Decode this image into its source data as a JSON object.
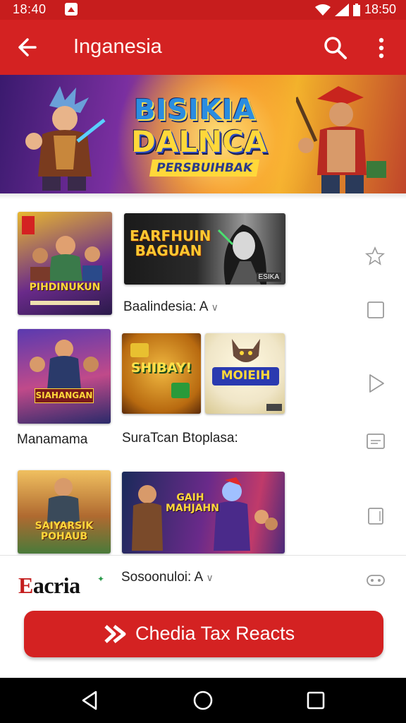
{
  "status_bar": {
    "time_left": "18:40",
    "time_right": "18:50",
    "icons": [
      "notification-icon",
      "wifi-icon",
      "signal-icon",
      "battery-icon"
    ]
  },
  "app_bar": {
    "title": "Inganesia",
    "icons": [
      "back-arrow-icon",
      "search-icon",
      "more-vert-icon"
    ]
  },
  "banner": {
    "line1": "BISIKIA",
    "line2": "DALNCA",
    "line3": "PERSBUIHBAK"
  },
  "rows": [
    {
      "label": "",
      "tiles": [
        {
          "name": "game-tile-fighters",
          "caption": "PIHDINUKUN"
        },
        {
          "name": "game-tile-earfhuin",
          "caption": "EARFHUIN BAGUAN",
          "badge": "ESIKA"
        }
      ],
      "item_label": "Baalindesia: A",
      "side_icons": [
        "star-outline-icon",
        "square-outline-icon"
      ]
    },
    {
      "label": "Manamama",
      "tiles": [
        {
          "name": "game-tile-heroes",
          "caption": "SIAHANGAN"
        },
        {
          "name": "game-tile-shibay",
          "caption": "SHIBAY!"
        },
        {
          "name": "game-tile-moieih",
          "caption": "MOIEIH"
        }
      ],
      "item_label": "SuraTcan Btoplasa:",
      "side_icons": [
        "play-outline-icon",
        "card-outline-icon"
      ]
    },
    {
      "label": "",
      "tiles": [
        {
          "name": "game-tile-saiyarsik",
          "caption": "SAIYARSIK POHAUB"
        },
        {
          "name": "game-tile-gaih",
          "caption": "GAIH MAHJAHN"
        }
      ],
      "side_icons": [
        "tablet-outline-icon"
      ]
    }
  ],
  "bottom": {
    "logo": "Eacria",
    "item_label": "Sosoonuloi: A",
    "side_icon": "gamepad-outline-icon",
    "cta_label": "Chedia Tax Reacts"
  },
  "nav_bar": {
    "icons": [
      "back-triangle-icon",
      "home-circle-icon",
      "recents-square-icon"
    ]
  },
  "colors": {
    "primary": "#d42222",
    "status": "#c71d1d",
    "nav": "#000000"
  }
}
